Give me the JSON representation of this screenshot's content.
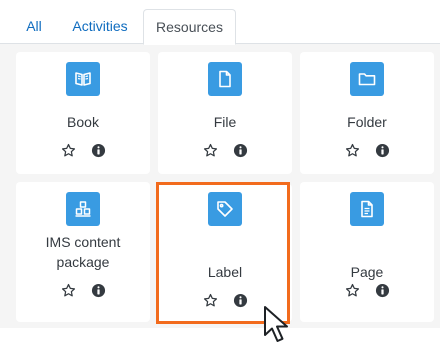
{
  "tabs": [
    {
      "label": "All",
      "active": false
    },
    {
      "label": "Activities",
      "active": false
    },
    {
      "label": "Resources",
      "active": true
    }
  ],
  "resources": [
    {
      "name": "Book",
      "icon": "book-icon"
    },
    {
      "name": "File",
      "icon": "file-icon"
    },
    {
      "name": "Folder",
      "icon": "folder-icon"
    },
    {
      "name": "IMS content package",
      "line1": "IMS content",
      "line2": "package",
      "icon": "package-icon"
    },
    {
      "name": "Label",
      "icon": "tag-icon"
    },
    {
      "name": "Page",
      "icon": "page-icon"
    }
  ],
  "actions": {
    "favourite_icon": "star-outline-icon",
    "info_icon": "info-circle-icon"
  },
  "colors": {
    "accent_blue": "#399be2",
    "tab_link": "#0f6cbf",
    "highlight_orange": "#f26b1d",
    "panel_bg": "#f5f5f5"
  },
  "highlighted_item": "Label"
}
